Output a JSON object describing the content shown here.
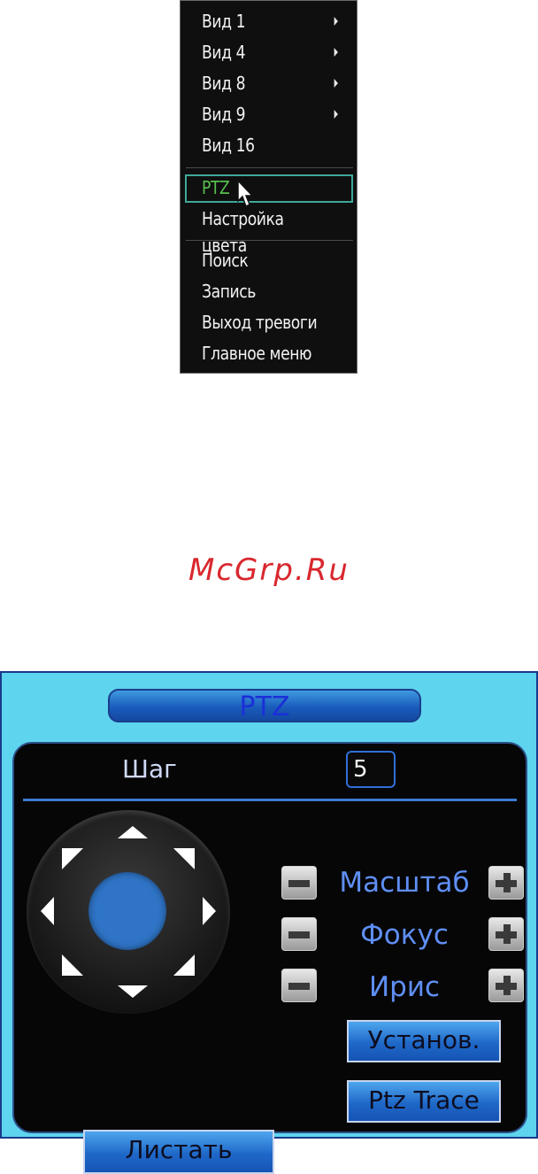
{
  "context_menu": {
    "items": [
      {
        "label": "Вид 1",
        "submenu": true
      },
      {
        "label": "Вид 4",
        "submenu": true
      },
      {
        "label": "Вид 8",
        "submenu": true
      },
      {
        "label": "Вид 9",
        "submenu": true
      },
      {
        "label": "Вид 16",
        "submenu": false
      },
      {
        "label": "PTZ",
        "submenu": false,
        "selected": true
      },
      {
        "label": "Настройка цвета",
        "submenu": false
      },
      {
        "label": "Поиск",
        "submenu": false
      },
      {
        "label": "Запись",
        "submenu": false
      },
      {
        "label": "Выход тревоги",
        "submenu": false
      },
      {
        "label": "Главное меню",
        "submenu": false
      }
    ]
  },
  "watermark": "McGrp.Ru",
  "ptz_panel": {
    "title": "PTZ",
    "step_label": "Шаг",
    "step_value": "5",
    "controls": [
      {
        "label": "Масштаб",
        "minus_icon": "minus-icon",
        "plus_icon": "plus-icon"
      },
      {
        "label": "Фокус",
        "minus_icon": "minus-icon",
        "plus_icon": "plus-icon"
      },
      {
        "label": "Ирис",
        "minus_icon": "minus-icon",
        "plus_icon": "plus-icon"
      }
    ],
    "set_button": "Установ.",
    "trace_button": "Ptz Trace",
    "page_button": "Листать"
  },
  "colors": {
    "menu_bg": "#0f0f0f",
    "menu_selected_text": "#56c04c",
    "selection_border": "#3fa89a",
    "watermark": "#d9272e",
    "panel_bg": "#5fd4ee",
    "button_blue": "#1f68c8",
    "label_blue": "#5f8ff5"
  }
}
